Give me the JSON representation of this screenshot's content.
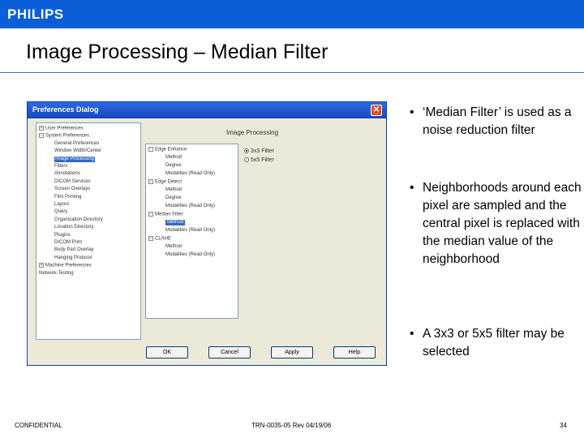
{
  "brand": "PHILIPS",
  "title": "Image Processing – Median Filter",
  "dialog": {
    "title": "Preferences Dialog",
    "close_label": "✕",
    "tree": [
      {
        "label": "User Preferences",
        "exp": "+"
      },
      {
        "label": "System Preferences",
        "exp": "−"
      },
      {
        "label": "General Preferences"
      },
      {
        "label": "Window Width/Center"
      },
      {
        "label": "Image Processing",
        "selected": true
      },
      {
        "label": "Filters"
      },
      {
        "label": "Annotations"
      },
      {
        "label": "DICOM Services"
      },
      {
        "label": "Screen Overlays"
      },
      {
        "label": "Film Printing"
      },
      {
        "label": "Layout"
      },
      {
        "label": "Query"
      },
      {
        "label": "Organization Directory"
      },
      {
        "label": "Location Directory"
      },
      {
        "label": "Plugins"
      },
      {
        "label": "DICOM Print"
      },
      {
        "label": "Body Part Overlay"
      },
      {
        "label": "Hanging Protocol"
      },
      {
        "label": "Machine Preferences",
        "exp": "+"
      },
      {
        "label": "Network Testing"
      }
    ],
    "section_title": "Image Processing",
    "options": [
      {
        "label": "Edge Enhance",
        "exp": "−"
      },
      {
        "label": "Method"
      },
      {
        "label": "Degree"
      },
      {
        "label": "Modalities (Read Only)"
      },
      {
        "label": "Edge Detect",
        "exp": "−"
      },
      {
        "label": "Method"
      },
      {
        "label": "Degree"
      },
      {
        "label": "Modalities (Read Only)"
      },
      {
        "label": "Median Filter",
        "exp": "−"
      },
      {
        "label": "Method",
        "selected": true
      },
      {
        "label": "Modalities (Read Only)"
      },
      {
        "label": "CLAHE",
        "exp": "−"
      },
      {
        "label": "Method"
      },
      {
        "label": "Modalities (Read Only)"
      }
    ],
    "radios": [
      {
        "label": "3x3 Filter",
        "checked": true
      },
      {
        "label": "5x5 Filter",
        "checked": false
      }
    ],
    "buttons": [
      "OK",
      "Cancel",
      "Apply",
      "Help"
    ]
  },
  "bullets": [
    "‘Median Filter’ is used as a noise reduction filter",
    "Neighborhoods around each pixel are sampled and the central pixel is replaced with the median value of the neighborhood",
    "A 3x3 or 5x5 filter may be selected"
  ],
  "bullet_symbol": "•",
  "footer": {
    "left": "CONFIDENTIAL",
    "center": "TRN-0035-05 Rev 04/19/06",
    "right": "34"
  },
  "colors": {
    "brand_bar": "#0b5ed7",
    "dialog_titlebar": "#1546c2",
    "selection": "#316ac5"
  }
}
